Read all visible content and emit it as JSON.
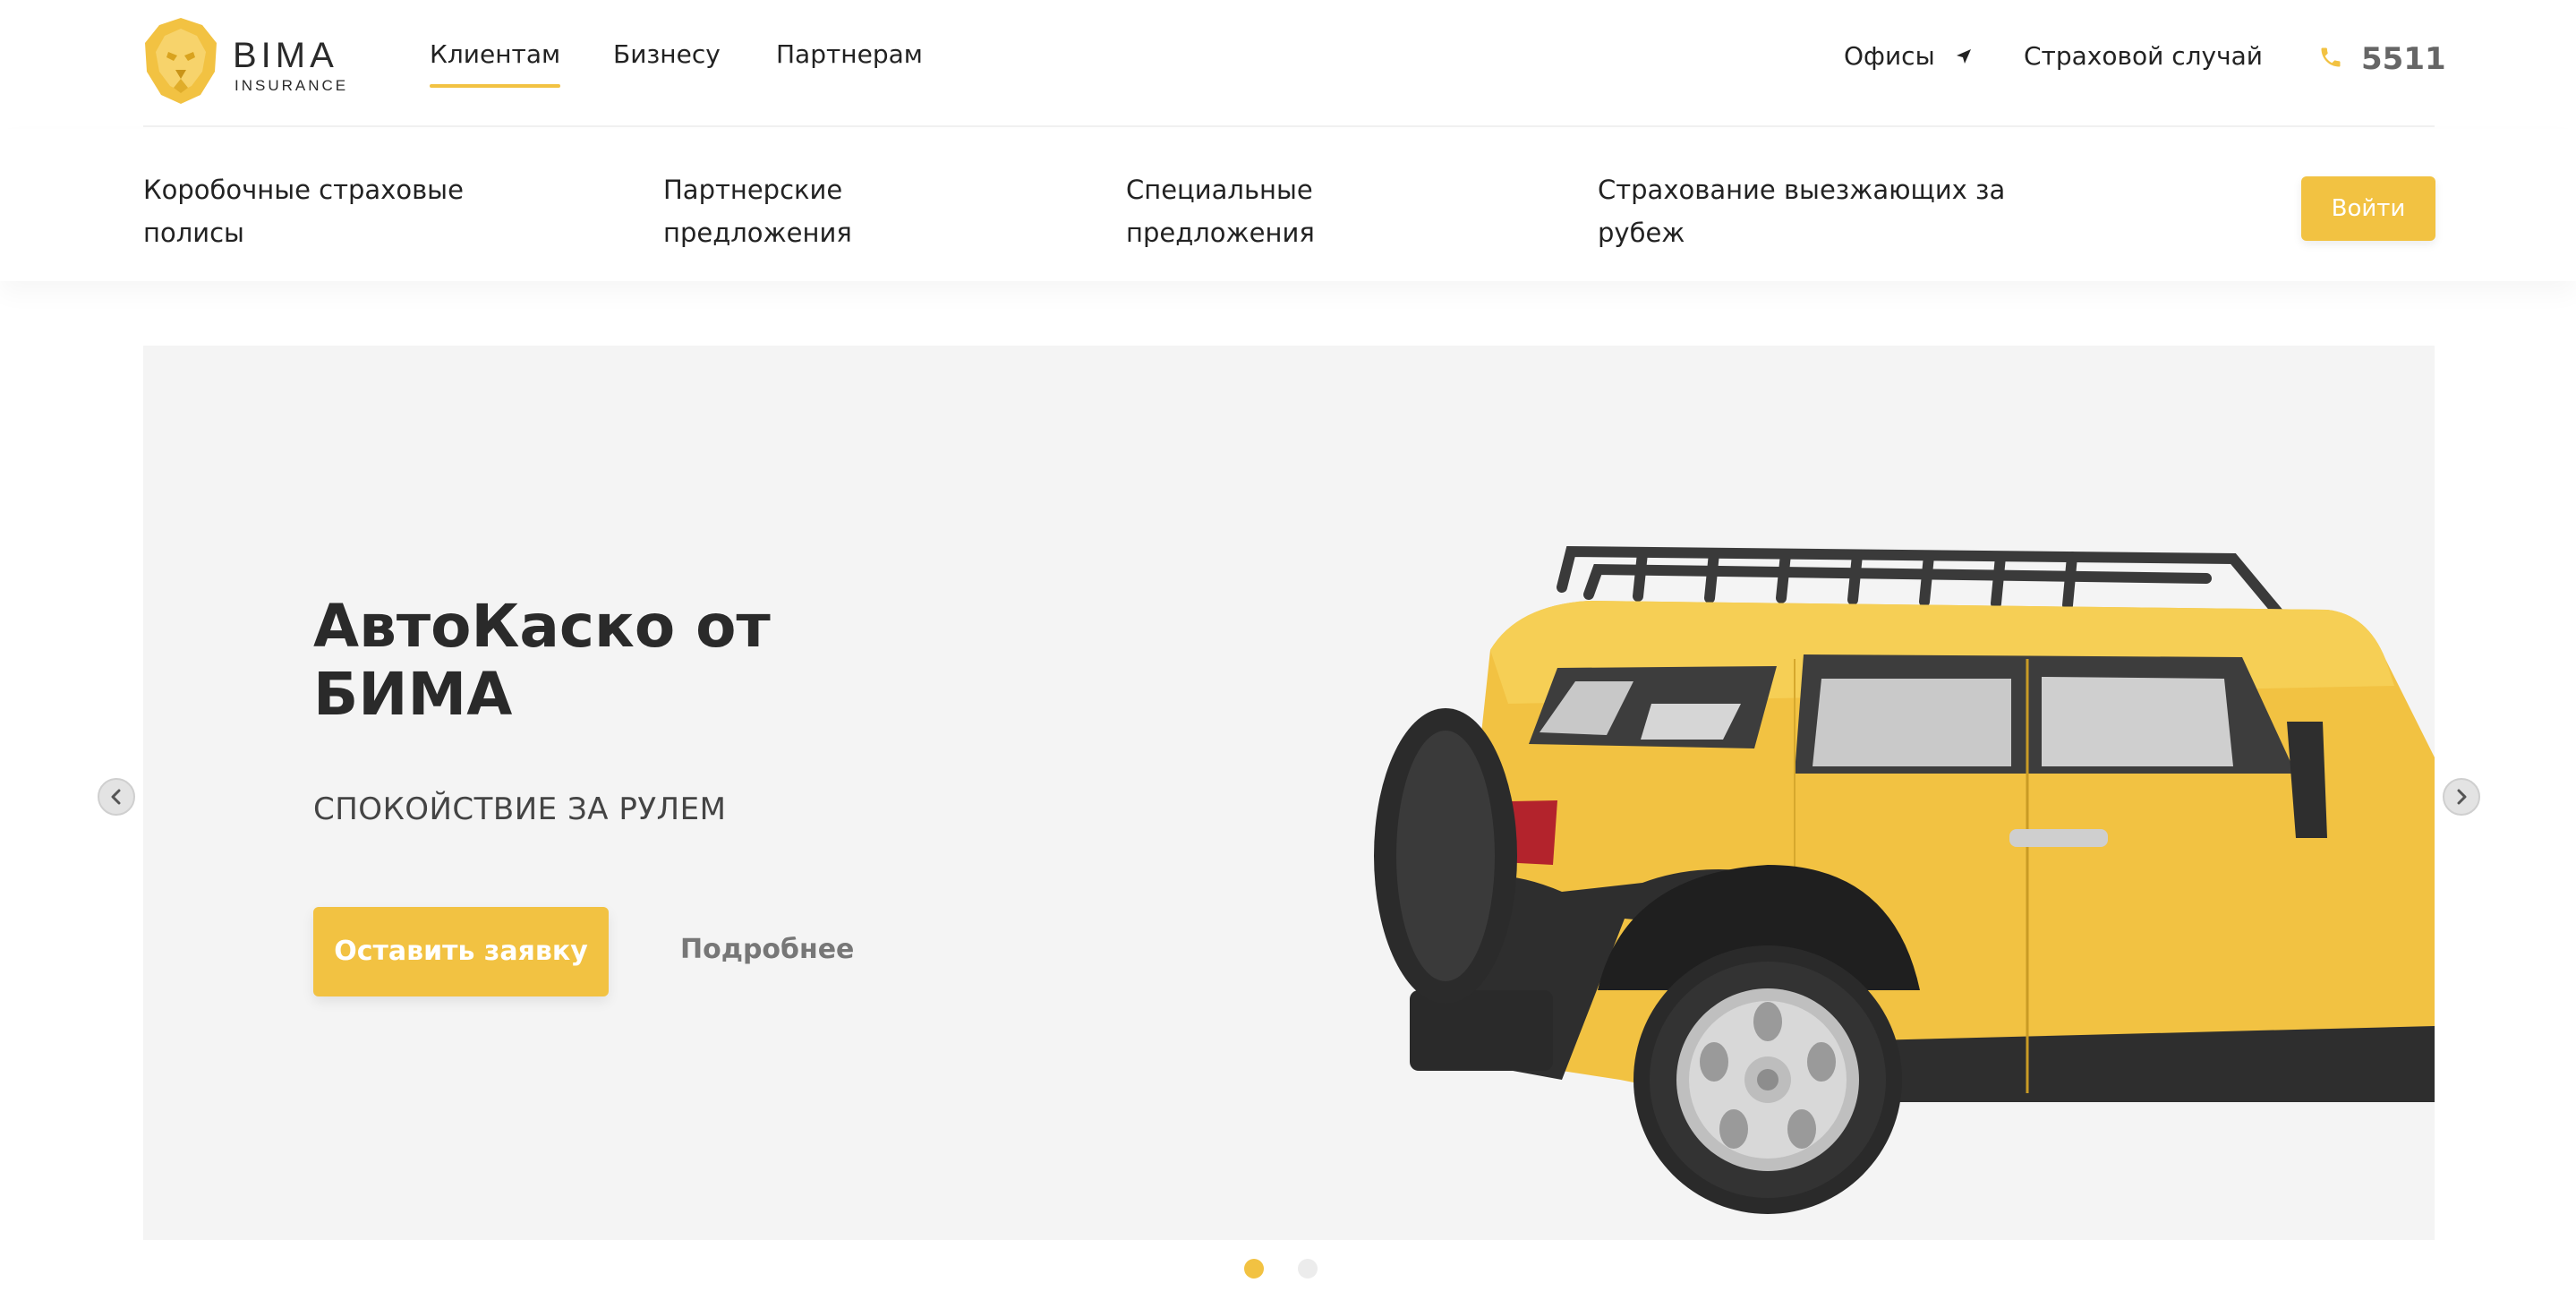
{
  "brand": {
    "name": "BIMA",
    "tagline": "INSURANCE",
    "accent_color": "#f2c242"
  },
  "header": {
    "nav": [
      {
        "label": "Клиентам",
        "active": true
      },
      {
        "label": "Бизнесу",
        "active": false
      },
      {
        "label": "Партнерам",
        "active": false
      }
    ],
    "offices_label": "Офисы",
    "claim_label": "Страховой случай",
    "phone": "5511",
    "phone_icon": "phone-icon"
  },
  "subnav": {
    "items": [
      "Коробочные страховые полисы",
      "Партнерские предложения",
      "Специальные предложения",
      "Страхование выезжающих за рубеж"
    ],
    "login_label": "Войти"
  },
  "hero": {
    "title": "АвтоКаско от БИМА",
    "subtitle": "СПОКОЙСТВИЕ ЗА РУЛЕМ",
    "cta_label": "Оставить заявку",
    "more_label": "Подробнее",
    "background_color": "#f4f4f4",
    "image": "yellow-suv-illustration"
  },
  "slider": {
    "slide_count": 2,
    "active_slide": 1
  }
}
